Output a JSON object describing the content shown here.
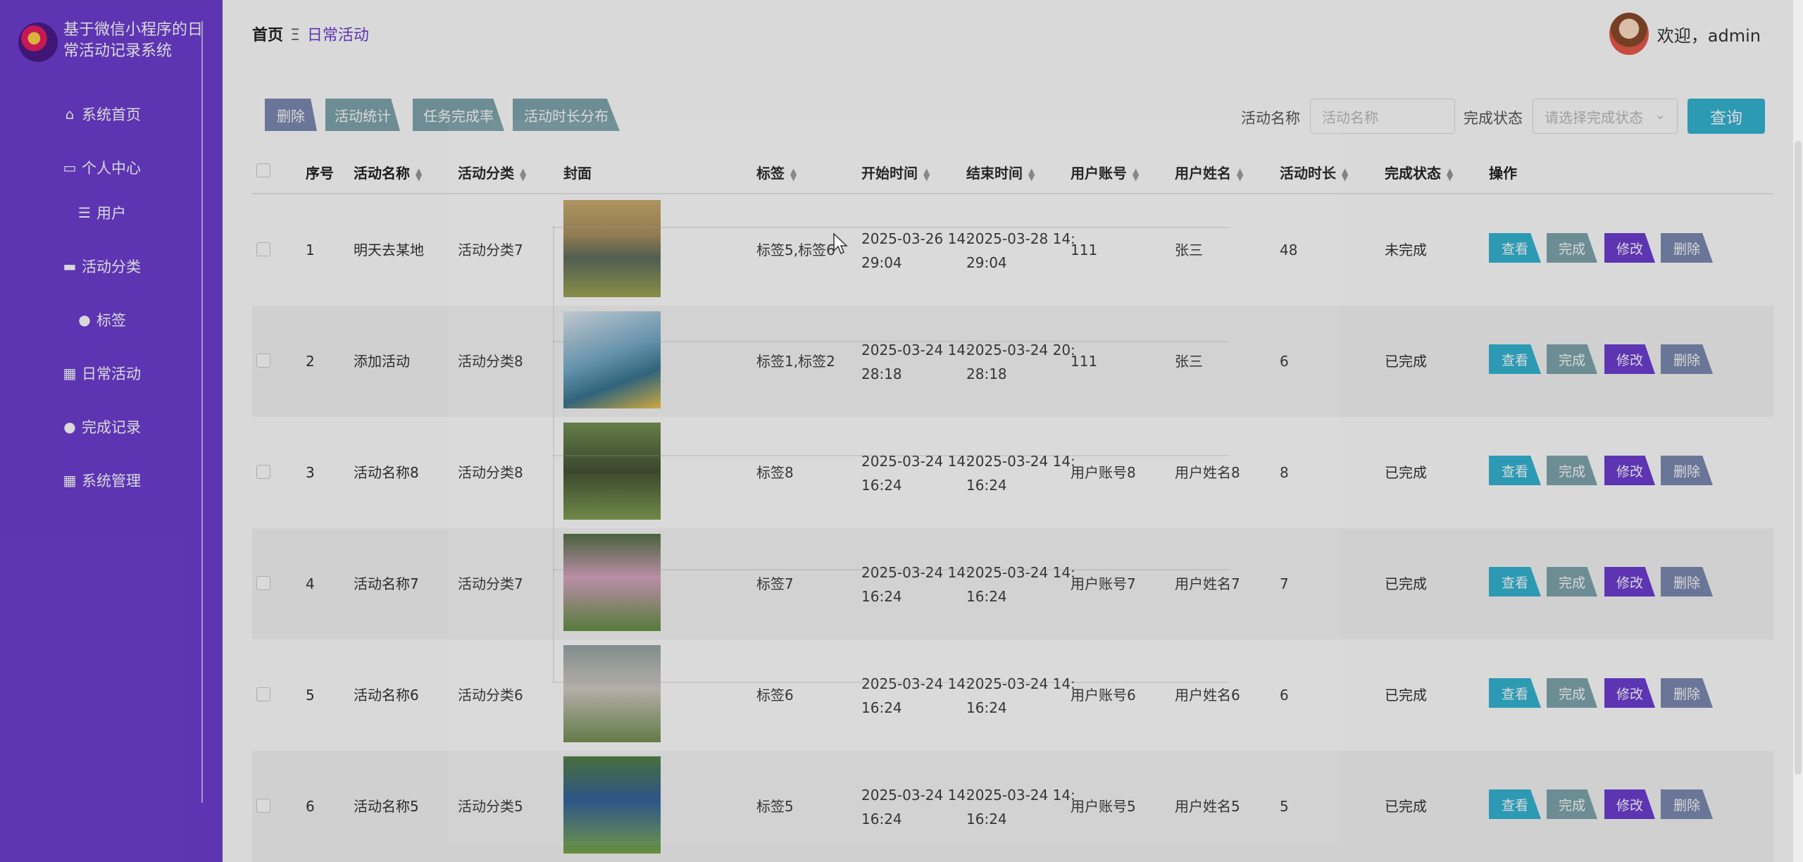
{
  "app": {
    "title": "基于微信小程序的日常活动记录系统"
  },
  "sidebar": {
    "items": [
      {
        "label": "系统首页",
        "icon": "home-icon"
      },
      {
        "label": "个人中心",
        "icon": "card-icon"
      },
      {
        "label": "用户",
        "icon": "list-icon"
      },
      {
        "label": "活动分类",
        "icon": "monitor-icon"
      },
      {
        "label": "标签",
        "icon": "user-icon"
      },
      {
        "label": "日常活动",
        "icon": "grid-icon"
      },
      {
        "label": "完成记录",
        "icon": "user-icon"
      },
      {
        "label": "系统管理",
        "icon": "grid-icon"
      }
    ]
  },
  "header": {
    "breadcrumb_home": "首页",
    "breadcrumb_sep": "Ξ",
    "breadcrumb_current": "日常活动",
    "welcome": "欢迎，admin"
  },
  "toolbar": {
    "buttons": [
      "删除",
      "活动统计",
      "任务完成率",
      "活动时长分布"
    ],
    "search_name_label": "活动名称",
    "search_name_placeholder": "活动名称",
    "search_status_label": "完成状态",
    "search_status_placeholder": "请选择完成状态",
    "query_label": "查询"
  },
  "table": {
    "columns": [
      "序号",
      "活动名称",
      "活动分类",
      "封面",
      "标签",
      "开始时间",
      "结束时间",
      "用户账号",
      "用户姓名",
      "活动时长",
      "完成状态",
      "操作"
    ],
    "actions": [
      "查看",
      "完成",
      "修改",
      "删除"
    ],
    "rows": [
      {
        "no": "1",
        "name": "明天去某地",
        "category": "活动分类7",
        "tags": "标签5,标签6",
        "start1": "2025-03-26 14:",
        "start2": "29:04",
        "end1": "2025-03-28 14:",
        "end2": "29:04",
        "account": "111",
        "username": "张三",
        "duration": "48",
        "status": "未完成"
      },
      {
        "no": "2",
        "name": "添加活动",
        "category": "活动分类8",
        "tags": "标签1,标签2",
        "start1": "2025-03-24 14:",
        "start2": "28:18",
        "end1": "2025-03-24 20:",
        "end2": "28:18",
        "account": "111",
        "username": "张三",
        "duration": "6",
        "status": "已完成"
      },
      {
        "no": "3",
        "name": "活动名称8",
        "category": "活动分类8",
        "tags": "标签8",
        "start1": "2025-03-24 14:",
        "start2": "16:24",
        "end1": "2025-03-24 14:",
        "end2": "16:24",
        "account": "用户账号8",
        "username": "用户姓名8",
        "duration": "8",
        "status": "已完成"
      },
      {
        "no": "4",
        "name": "活动名称7",
        "category": "活动分类7",
        "tags": "标签7",
        "start1": "2025-03-24 14:",
        "start2": "16:24",
        "end1": "2025-03-24 14:",
        "end2": "16:24",
        "account": "用户账号7",
        "username": "用户姓名7",
        "duration": "7",
        "status": "已完成"
      },
      {
        "no": "5",
        "name": "活动名称6",
        "category": "活动分类6",
        "tags": "标签6",
        "start1": "2025-03-24 14:",
        "start2": "16:24",
        "end1": "2025-03-24 14:",
        "end2": "16:24",
        "account": "用户账号6",
        "username": "用户姓名6",
        "duration": "6",
        "status": "已完成"
      },
      {
        "no": "6",
        "name": "活动名称5",
        "category": "活动分类5",
        "tags": "标签5",
        "start1": "2025-03-24 14:",
        "start2": "16:24",
        "end1": "2025-03-24 14:",
        "end2": "16:24",
        "account": "用户账号5",
        "username": "用户姓名5",
        "duration": "5",
        "status": "已完成"
      }
    ]
  },
  "colors": {
    "sidebar": "#6e3fd3",
    "view": "#36b6d4",
    "complete": "#7fa6ad",
    "edit": "#6e3fd3",
    "delete": "#7d8bb3"
  }
}
